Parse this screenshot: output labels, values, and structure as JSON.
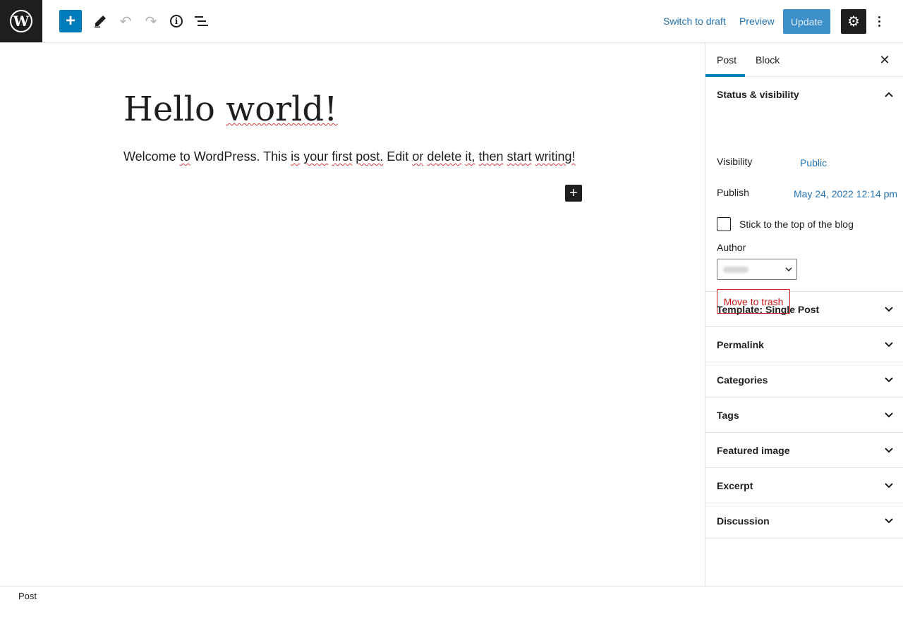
{
  "toolbar": {
    "logo_icon": "wordpress-logo-icon",
    "add_block_icon": "plus-icon",
    "tools_icon": "pencil-icon",
    "undo_icon": "undo-icon",
    "redo_icon": "redo-icon",
    "details_icon": "info-icon",
    "outline_icon": "list-view-icon",
    "switch_to_draft_label": "Switch to draft",
    "preview_label": "Preview",
    "update_label": "Update",
    "settings_icon": "gear-icon",
    "options_icon": "more-vertical-icon"
  },
  "editor": {
    "title": "Hello world!",
    "body": "Welcome to WordPress. This is your first post. Edit or delete it, then start writing!",
    "block_inserter_icon": "plus-icon"
  },
  "sidebar": {
    "tabs": [
      {
        "label": "Post",
        "active": true
      },
      {
        "label": "Block",
        "active": false
      }
    ],
    "close_icon": "close-icon",
    "status_panel": {
      "title": "Status & visibility",
      "visibility_label": "Visibility",
      "visibility_value": "Public",
      "publish_label": "Publish",
      "publish_value": "May 24, 2022 12:14 pm",
      "stick_label": "Stick to the top of the blog",
      "author_label": "Author",
      "trash_label": "Move to trash"
    },
    "panels": [
      {
        "label": "Template: Single Post"
      },
      {
        "label": "Permalink"
      },
      {
        "label": "Categories"
      },
      {
        "label": "Tags"
      },
      {
        "label": "Featured image"
      },
      {
        "label": "Excerpt"
      },
      {
        "label": "Discussion"
      }
    ]
  },
  "footer": {
    "breadcrumb": "Post"
  },
  "colors": {
    "accent": "#007cba",
    "link": "#2271b1",
    "danger": "#cc1818",
    "dark": "#1e1e1e"
  }
}
